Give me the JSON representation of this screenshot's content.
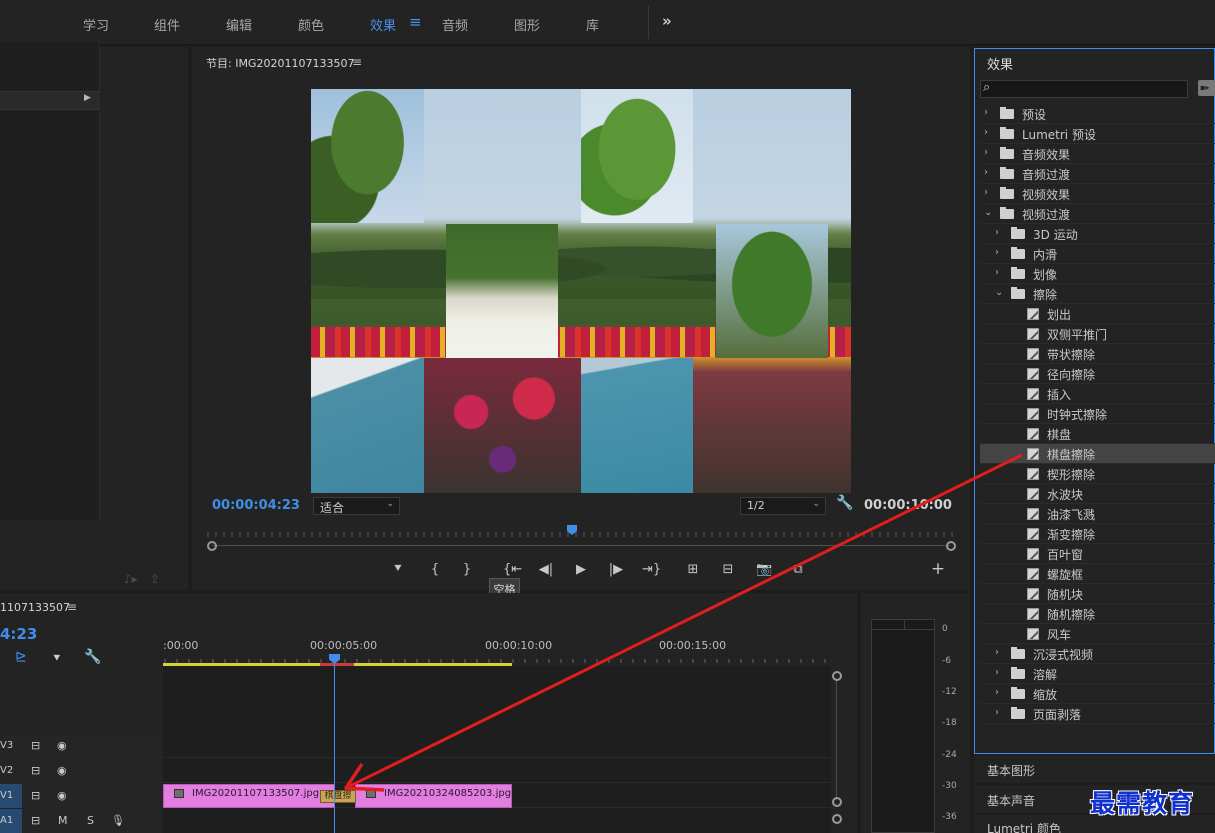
{
  "workspace_tabs": [
    "学习",
    "组件",
    "编辑",
    "颜色",
    "效果",
    "音频",
    "图形",
    "库"
  ],
  "workspace_active": "效果",
  "workspace_more": "»",
  "program": {
    "title": "节目: IMG20201107133507",
    "menu_icon": "≡",
    "timecode_current": "00:00:04:23",
    "fit": "适合",
    "resolution": "1/2",
    "timecode_duration": "00:00:10:00",
    "tooltip": "空格"
  },
  "timeline": {
    "title": "1107133507",
    "menu_icon": "≡",
    "timecode": "4:23",
    "ruler_labels": [
      ":00:00",
      "00:00:05:00",
      "00:00:10:00",
      "00:00:15:00"
    ],
    "tracks": [
      {
        "id": "V3",
        "btn1": "⊟",
        "btn2": "◉"
      },
      {
        "id": "V2",
        "btn1": "⊟",
        "btn2": "◉"
      },
      {
        "id": "V1",
        "btn1": "⊟",
        "btn2": "◉"
      },
      {
        "id": "A1",
        "btn1": "⊟",
        "btn2": "M",
        "btn3": "S",
        "btn4": "🎙"
      }
    ],
    "clips": [
      {
        "name": "IMG20201107133507.jpg"
      },
      {
        "name": "IMG20210324085203.jpg"
      }
    ],
    "transition_label": "棋盘擦"
  },
  "meter": {
    "labels": [
      "0",
      "-6",
      "-12",
      "-18",
      "-24",
      "-30",
      "-36"
    ]
  },
  "effects": {
    "title": "效果",
    "search_placeholder": "",
    "tree": [
      {
        "label": "预设",
        "kind": "preset",
        "depth": 0,
        "open": false
      },
      {
        "label": "Lumetri 预设",
        "kind": "preset",
        "depth": 0,
        "open": false
      },
      {
        "label": "音频效果",
        "kind": "folder",
        "depth": 0,
        "open": false
      },
      {
        "label": "音频过渡",
        "kind": "folder",
        "depth": 0,
        "open": false
      },
      {
        "label": "视频效果",
        "kind": "folder",
        "depth": 0,
        "open": false
      },
      {
        "label": "视频过渡",
        "kind": "folder",
        "depth": 0,
        "open": true
      },
      {
        "label": "3D 运动",
        "kind": "folder",
        "depth": 1,
        "open": false
      },
      {
        "label": "内滑",
        "kind": "folder",
        "depth": 1,
        "open": false
      },
      {
        "label": "划像",
        "kind": "folder",
        "depth": 1,
        "open": false
      },
      {
        "label": "擦除",
        "kind": "folder",
        "depth": 1,
        "open": true
      },
      {
        "label": "划出",
        "kind": "effect",
        "depth": 2
      },
      {
        "label": "双侧平推门",
        "kind": "effect",
        "depth": 2
      },
      {
        "label": "带状擦除",
        "kind": "effect",
        "depth": 2
      },
      {
        "label": "径向擦除",
        "kind": "effect",
        "depth": 2
      },
      {
        "label": "插入",
        "kind": "effect",
        "depth": 2
      },
      {
        "label": "时钟式擦除",
        "kind": "effect",
        "depth": 2
      },
      {
        "label": "棋盘",
        "kind": "effect",
        "depth": 2
      },
      {
        "label": "棋盘擦除",
        "kind": "effect",
        "depth": 2,
        "selected": true
      },
      {
        "label": "楔形擦除",
        "kind": "effect",
        "depth": 2
      },
      {
        "label": "水波块",
        "kind": "effect",
        "depth": 2
      },
      {
        "label": "油漆飞溅",
        "kind": "effect",
        "depth": 2
      },
      {
        "label": "渐变擦除",
        "kind": "effect",
        "depth": 2
      },
      {
        "label": "百叶窗",
        "kind": "effect",
        "depth": 2
      },
      {
        "label": "螺旋框",
        "kind": "effect",
        "depth": 2
      },
      {
        "label": "随机块",
        "kind": "effect",
        "depth": 2
      },
      {
        "label": "随机擦除",
        "kind": "effect",
        "depth": 2
      },
      {
        "label": "风车",
        "kind": "effect",
        "depth": 2
      },
      {
        "label": "沉浸式视频",
        "kind": "folder",
        "depth": 1,
        "open": false
      },
      {
        "label": "溶解",
        "kind": "folder",
        "depth": 1,
        "open": false
      },
      {
        "label": "缩放",
        "kind": "folder",
        "depth": 1,
        "open": false
      },
      {
        "label": "页面剥落",
        "kind": "folder",
        "depth": 1,
        "open": false
      }
    ]
  },
  "side_panels": [
    "基本图形",
    "基本声音",
    "Lumetri 颜色"
  ],
  "watermark": "最需教育",
  "colors": {
    "accent": "#3f8fe8",
    "clip": "#e17ee0",
    "annotation_arrow": "#e01e1e"
  }
}
